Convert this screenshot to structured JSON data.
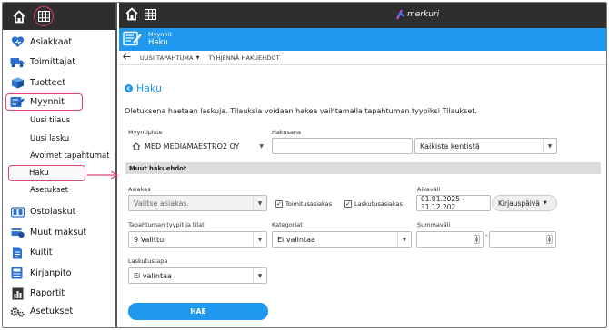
{
  "sidebar": {
    "items": [
      {
        "label": "Asiakkaat",
        "icon": "heart-icon"
      },
      {
        "label": "Toimittajat",
        "icon": "truck-icon"
      },
      {
        "label": "Tuotteet",
        "icon": "box-icon"
      },
      {
        "label": "Myynnit",
        "icon": "sales-icon"
      }
    ],
    "sub_items": [
      "Uusi tilaus",
      "Uusi lasku",
      "Avoimet tapahtumat",
      "Haku",
      "Asetukset"
    ],
    "lower_items": [
      {
        "label": "Ostolaskut",
        "icon": "purchase-icon"
      },
      {
        "label": "Muut maksut",
        "icon": "payment-icon"
      },
      {
        "label": "Kuitit",
        "icon": "receipt-icon"
      },
      {
        "label": "Kirjanpito",
        "icon": "ledger-icon"
      },
      {
        "label": "Raportit",
        "icon": "report-icon"
      }
    ],
    "settings_label": "Asetukset"
  },
  "header": {
    "logo_text": "merkuri",
    "breadcrumb_parent": "Myynnit",
    "breadcrumb_current": "Haku"
  },
  "toolbar": {
    "new_event": "UUSI TAPAHTUMA",
    "clear": "TYHJENNÄ HAKUEHDOT"
  },
  "page": {
    "title": "Haku",
    "description": "Oletuksena haetaan laskuja. Tilauksia voidaan hakea vaihtamalla tapahtuman tyypiksi Tilaukset."
  },
  "form": {
    "myyntipiste_label": "Myyntipiste",
    "myyntipiste_value": "MED MEDIAMAESTRO2 OY",
    "hakusana_label": "Hakusana",
    "hakusana_value": "",
    "hakusana_scope": "Kaikista kentistä",
    "section_title": "Muut hakuehdot",
    "asiakas_label": "Asiakas",
    "asiakas_placeholder": "Valitse asiakas",
    "toimitusasiakas": "Toimitusasiakas",
    "laskutusasiakas": "Laskutusasiakas",
    "aikavali_label": "Aikaväli",
    "aikavali_value": "01.01.2025 - 31.12.202",
    "aikavali_type": "Kirjauspäivä",
    "tyypit_label": "Tapahtuman tyypit ja tilat",
    "tyypit_value": "9 Valittu",
    "kategoriat_label": "Kategoriat",
    "kategoriat_value": "Ei valintaa",
    "summavali_label": "Summaväli",
    "summavali_separator": "-",
    "laskutustapa_label": "Laskutustapa",
    "laskutustapa_value": "Ei valintaa",
    "search_button": "HAE"
  },
  "colors": {
    "accent": "#1f98f0",
    "highlight": "#e0407a",
    "dark_bar": "#2e2e2e"
  }
}
